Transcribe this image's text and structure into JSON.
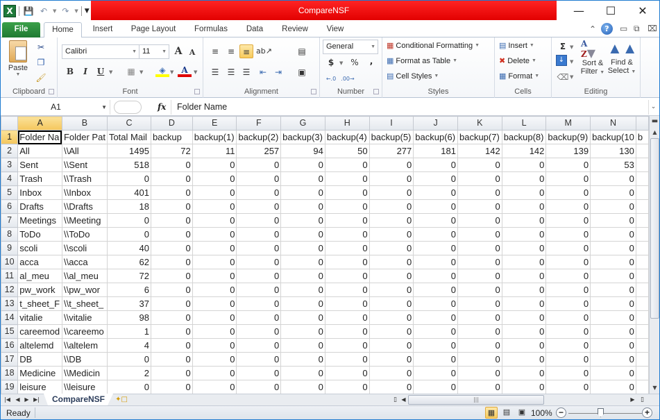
{
  "window": {
    "title": "CompareNSF",
    "title_color": "#e80000",
    "controls": {
      "minimize": "—",
      "maximize": "☐",
      "close": "✕"
    }
  },
  "qat": {
    "app_icon": "X",
    "save_icon": "save-icon",
    "undo_icon": "undo-icon",
    "redo_icon": "redo-icon"
  },
  "ribbon_tabs": [
    {
      "label": "File",
      "active": false
    },
    {
      "label": "Home",
      "active": true
    },
    {
      "label": "Insert",
      "active": false
    },
    {
      "label": "Page Layout",
      "active": false
    },
    {
      "label": "Formulas",
      "active": false
    },
    {
      "label": "Data",
      "active": false
    },
    {
      "label": "Review",
      "active": false
    },
    {
      "label": "View",
      "active": false
    }
  ],
  "ribbon": {
    "clipboard": {
      "label": "Clipboard",
      "paste": "Paste"
    },
    "font": {
      "label": "Font",
      "font_name": "Calibri",
      "font_size": "11",
      "bold": "B",
      "italic": "I",
      "underline": "U",
      "grow": "A",
      "shrink": "A",
      "font_color": "A"
    },
    "alignment": {
      "label": "Alignment"
    },
    "number": {
      "label": "Number",
      "format": "General",
      "currency": "$",
      "percent": "%",
      "comma": ",",
      "inc_decimal": "←.0 .00",
      "dec_decimal": ".00 →.0"
    },
    "styles": {
      "label": "Styles",
      "conditional": "Conditional Formatting",
      "format_table": "Format as Table",
      "cell_styles": "Cell Styles"
    },
    "cells": {
      "label": "Cells",
      "insert": "Insert",
      "delete": "Delete",
      "format": "Format"
    },
    "editing": {
      "label": "Editing",
      "sum": "Σ",
      "sort_filter_1": "Sort &",
      "sort_filter_2": "Filter",
      "find_select_1": "Find &",
      "find_select_2": "Select"
    }
  },
  "formula_bar": {
    "name_box": "A1",
    "fx": "fx",
    "content": "Folder Name"
  },
  "sheet": {
    "columns": [
      "A",
      "B",
      "C",
      "D",
      "E",
      "F",
      "G",
      "H",
      "I",
      "J",
      "K",
      "L",
      "M",
      "N",
      ""
    ],
    "selected_column": "A",
    "selected_row": "1",
    "header_row": [
      "Folder Na",
      "Folder Pat",
      "Total Mail",
      "backup",
      "backup(1)",
      "backup(2)",
      "backup(3)",
      "backup(4)",
      "backup(5)",
      "backup(6)",
      "backup(7)",
      "backup(8)",
      "backup(9)",
      "backup(10",
      "b"
    ],
    "rows": [
      {
        "n": "2",
        "cells": [
          "All",
          "\\\\All",
          "1495",
          "72",
          "11",
          "257",
          "94",
          "50",
          "277",
          "181",
          "142",
          "142",
          "139",
          "130",
          ""
        ]
      },
      {
        "n": "3",
        "cells": [
          "Sent",
          "\\\\Sent",
          "518",
          "0",
          "0",
          "0",
          "0",
          "0",
          "0",
          "0",
          "0",
          "0",
          "0",
          "53",
          ""
        ]
      },
      {
        "n": "4",
        "cells": [
          "Trash",
          "\\\\Trash",
          "0",
          "0",
          "0",
          "0",
          "0",
          "0",
          "0",
          "0",
          "0",
          "0",
          "0",
          "0",
          ""
        ]
      },
      {
        "n": "5",
        "cells": [
          "Inbox",
          "\\\\Inbox",
          "401",
          "0",
          "0",
          "0",
          "0",
          "0",
          "0",
          "0",
          "0",
          "0",
          "0",
          "0",
          ""
        ]
      },
      {
        "n": "6",
        "cells": [
          "Drafts",
          "\\\\Drafts",
          "18",
          "0",
          "0",
          "0",
          "0",
          "0",
          "0",
          "0",
          "0",
          "0",
          "0",
          "0",
          ""
        ]
      },
      {
        "n": "7",
        "cells": [
          "Meetings",
          "\\\\Meeting",
          "0",
          "0",
          "0",
          "0",
          "0",
          "0",
          "0",
          "0",
          "0",
          "0",
          "0",
          "0",
          ""
        ]
      },
      {
        "n": "8",
        "cells": [
          "ToDo",
          "\\\\ToDo",
          "0",
          "0",
          "0",
          "0",
          "0",
          "0",
          "0",
          "0",
          "0",
          "0",
          "0",
          "0",
          ""
        ]
      },
      {
        "n": "9",
        "cells": [
          "scoli",
          "\\\\scoli",
          "40",
          "0",
          "0",
          "0",
          "0",
          "0",
          "0",
          "0",
          "0",
          "0",
          "0",
          "0",
          ""
        ]
      },
      {
        "n": "10",
        "cells": [
          "acca",
          "\\\\acca",
          "62",
          "0",
          "0",
          "0",
          "0",
          "0",
          "0",
          "0",
          "0",
          "0",
          "0",
          "0",
          ""
        ]
      },
      {
        "n": "11",
        "cells": [
          "al_meu",
          "\\\\al_meu",
          "72",
          "0",
          "0",
          "0",
          "0",
          "0",
          "0",
          "0",
          "0",
          "0",
          "0",
          "0",
          ""
        ]
      },
      {
        "n": "12",
        "cells": [
          "pw_work",
          "\\\\pw_wor",
          "6",
          "0",
          "0",
          "0",
          "0",
          "0",
          "0",
          "0",
          "0",
          "0",
          "0",
          "0",
          ""
        ]
      },
      {
        "n": "13",
        "cells": [
          "t_sheet_F",
          "\\\\t_sheet_",
          "37",
          "0",
          "0",
          "0",
          "0",
          "0",
          "0",
          "0",
          "0",
          "0",
          "0",
          "0",
          ""
        ]
      },
      {
        "n": "14",
        "cells": [
          "vitalie",
          "\\\\vitalie",
          "98",
          "0",
          "0",
          "0",
          "0",
          "0",
          "0",
          "0",
          "0",
          "0",
          "0",
          "0",
          ""
        ]
      },
      {
        "n": "15",
        "cells": [
          "careemod",
          "\\\\careemo",
          "1",
          "0",
          "0",
          "0",
          "0",
          "0",
          "0",
          "0",
          "0",
          "0",
          "0",
          "0",
          ""
        ]
      },
      {
        "n": "16",
        "cells": [
          "altelemd",
          "\\\\altelem",
          "4",
          "0",
          "0",
          "0",
          "0",
          "0",
          "0",
          "0",
          "0",
          "0",
          "0",
          "0",
          ""
        ]
      },
      {
        "n": "17",
        "cells": [
          "DB",
          "\\\\DB",
          "0",
          "0",
          "0",
          "0",
          "0",
          "0",
          "0",
          "0",
          "0",
          "0",
          "0",
          "0",
          ""
        ]
      },
      {
        "n": "18",
        "cells": [
          "Medicine",
          "\\\\Medicin",
          "2",
          "0",
          "0",
          "0",
          "0",
          "0",
          "0",
          "0",
          "0",
          "0",
          "0",
          "0",
          ""
        ]
      },
      {
        "n": "19",
        "cells": [
          "leisure",
          "\\\\leisure",
          "0",
          "0",
          "0",
          "0",
          "0",
          "0",
          "0",
          "0",
          "0",
          "0",
          "0",
          "0",
          ""
        ]
      }
    ]
  },
  "sheet_tabs": {
    "active": "CompareNSF"
  },
  "status_bar": {
    "status": "Ready",
    "zoom": "100%",
    "zoom_minus": "−",
    "zoom_plus": "+"
  }
}
